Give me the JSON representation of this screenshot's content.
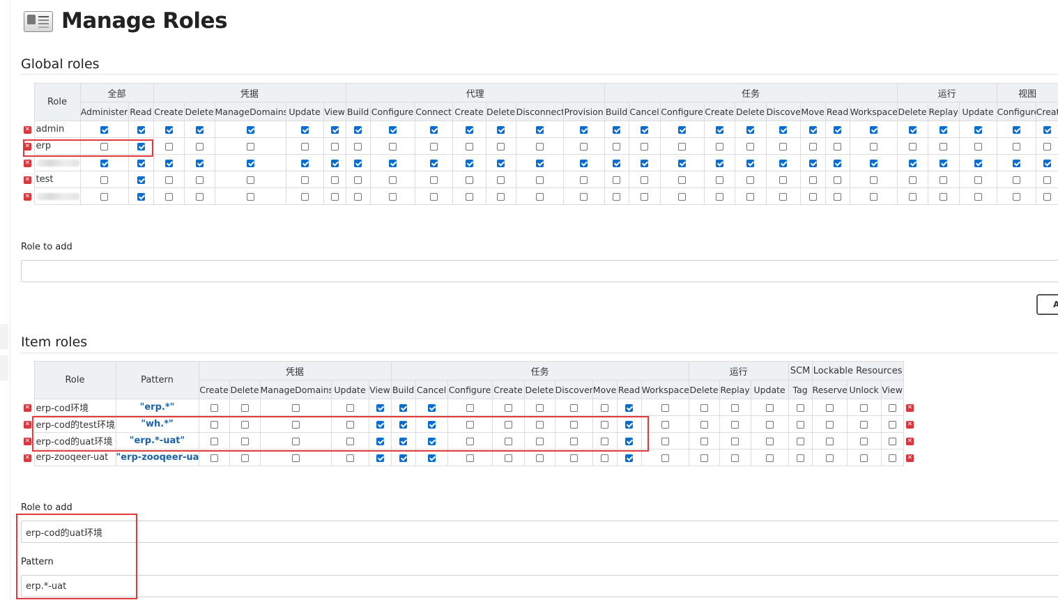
{
  "page": {
    "title": "Manage Roles"
  },
  "global_roles": {
    "heading": "Global roles",
    "role_header": "Role",
    "groups": [
      {
        "label": "全部",
        "perms": [
          "Administer",
          "Read"
        ]
      },
      {
        "label": "凭据",
        "perms": [
          "Create",
          "Delete",
          "ManageDomains",
          "Update",
          "View"
        ]
      },
      {
        "label": "代理",
        "perms": [
          "Build",
          "Configure",
          "Connect",
          "Create",
          "Delete",
          "Disconnect",
          "Provision"
        ]
      },
      {
        "label": "任务",
        "perms": [
          "Build",
          "Cancel",
          "Configure",
          "Create",
          "Delete",
          "Discover",
          "Move",
          "Read",
          "Workspace"
        ]
      },
      {
        "label": "运行",
        "perms": [
          "Delete",
          "Replay",
          "Update"
        ]
      },
      {
        "label": "视图",
        "perms": [
          "Configure",
          "Create"
        ]
      }
    ],
    "rows": [
      {
        "name": "admin",
        "checks": [
          1,
          1,
          1,
          1,
          1,
          1,
          1,
          1,
          1,
          1,
          1,
          1,
          1,
          1,
          1,
          1,
          1,
          1,
          1,
          1,
          1,
          1,
          1,
          1,
          1,
          1,
          1,
          1
        ]
      },
      {
        "name": "erp",
        "checks": [
          0,
          1,
          0,
          0,
          0,
          0,
          0,
          0,
          0,
          0,
          0,
          0,
          0,
          0,
          0,
          0,
          0,
          0,
          0,
          0,
          0,
          0,
          0,
          0,
          0,
          0,
          0,
          0
        ]
      },
      {
        "name": "",
        "checks": [
          1,
          1,
          1,
          1,
          1,
          1,
          1,
          1,
          1,
          1,
          1,
          1,
          1,
          1,
          1,
          1,
          1,
          1,
          1,
          1,
          1,
          1,
          1,
          1,
          1,
          1,
          1,
          1
        ]
      },
      {
        "name": "test",
        "checks": [
          0,
          1,
          0,
          0,
          0,
          0,
          0,
          0,
          0,
          0,
          0,
          0,
          0,
          0,
          0,
          0,
          0,
          0,
          0,
          0,
          0,
          0,
          0,
          0,
          0,
          0,
          0,
          0
        ]
      },
      {
        "name": "",
        "checks": [
          0,
          1,
          0,
          0,
          0,
          0,
          0,
          0,
          0,
          0,
          0,
          0,
          0,
          0,
          0,
          0,
          0,
          0,
          0,
          0,
          0,
          0,
          0,
          0,
          0,
          0,
          0,
          0
        ]
      }
    ],
    "role_to_add_label": "Role to add",
    "role_to_add_value": "",
    "add_button": "A"
  },
  "item_roles": {
    "heading": "Item roles",
    "role_header": "Role",
    "pattern_header": "Pattern",
    "groups": [
      {
        "label": "凭据",
        "perms": [
          "Create",
          "Delete",
          "ManageDomains",
          "Update",
          "View"
        ]
      },
      {
        "label": "任务",
        "perms": [
          "Build",
          "Cancel",
          "Configure",
          "Create",
          "Delete",
          "Discover",
          "Move",
          "Read",
          "Workspace"
        ]
      },
      {
        "label": "运行",
        "perms": [
          "Delete",
          "Replay",
          "Update"
        ]
      },
      {
        "label": "SCM",
        "perms": [
          "Tag"
        ]
      },
      {
        "label": "Lockable Resources",
        "perms": [
          "Reserve",
          "Unlock",
          "View"
        ]
      }
    ],
    "rows": [
      {
        "name": "erp-cod环境",
        "pattern": "\"erp.*\"",
        "checks": [
          0,
          0,
          0,
          0,
          1,
          1,
          1,
          0,
          0,
          0,
          0,
          0,
          1,
          0,
          0,
          0,
          0,
          0,
          0,
          0,
          0
        ]
      },
      {
        "name": "erp-cod的test环境",
        "pattern": "\"wh.*\"",
        "checks": [
          0,
          0,
          0,
          0,
          1,
          1,
          1,
          0,
          0,
          0,
          0,
          0,
          1,
          0,
          0,
          0,
          0,
          0,
          0,
          0,
          0
        ]
      },
      {
        "name": "erp-cod的uat环境",
        "pattern": "\"erp.*-uat\"",
        "checks": [
          0,
          0,
          0,
          0,
          1,
          1,
          1,
          0,
          0,
          0,
          0,
          0,
          1,
          0,
          0,
          0,
          0,
          0,
          0,
          0,
          0
        ]
      },
      {
        "name": "erp-zooqeer-uat",
        "pattern": "\"erp-zooqeer-uat\"",
        "checks": [
          0,
          0,
          0,
          0,
          1,
          1,
          1,
          0,
          0,
          0,
          0,
          0,
          1,
          0,
          0,
          0,
          0,
          0,
          0,
          0,
          0
        ]
      }
    ],
    "role_to_add_label": "Role to add",
    "role_to_add_value": "erp-cod的uat环境",
    "pattern_label": "Pattern",
    "pattern_value": "erp.*-uat"
  },
  "colors": {
    "checked": "#0a6ed1",
    "link": "#1b63a8",
    "highlight": "#e0393e",
    "header_bg": "#eef1f4"
  },
  "icons": {
    "page": "id-card-icon",
    "delete": "delete-x-icon"
  }
}
